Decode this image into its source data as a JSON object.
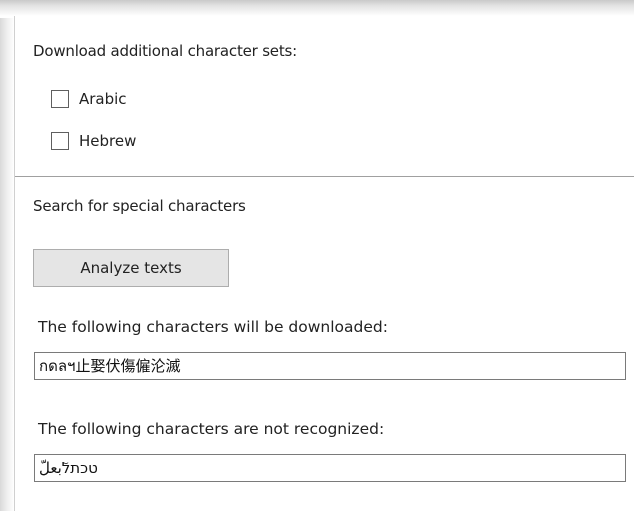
{
  "download_section": {
    "title": "Download additional character sets:",
    "options": [
      {
        "label": "Arabic",
        "checked": false
      },
      {
        "label": "Hebrew",
        "checked": false
      }
    ]
  },
  "search_section": {
    "title": "Search for special characters",
    "analyze_button_label": "Analyze texts",
    "downloaded_label": "The following characters will be downloaded:",
    "downloaded_value": "กดลฯ止娶伏傷僱沦滅",
    "not_recognized_label": "The following characters are not recognized:",
    "not_recognized_value": "טכתלٓبعلّ"
  },
  "colors": {
    "button_bg": "#e5e5e5",
    "divider": "#a0a0a0",
    "field_border": "#7a7a7a"
  }
}
